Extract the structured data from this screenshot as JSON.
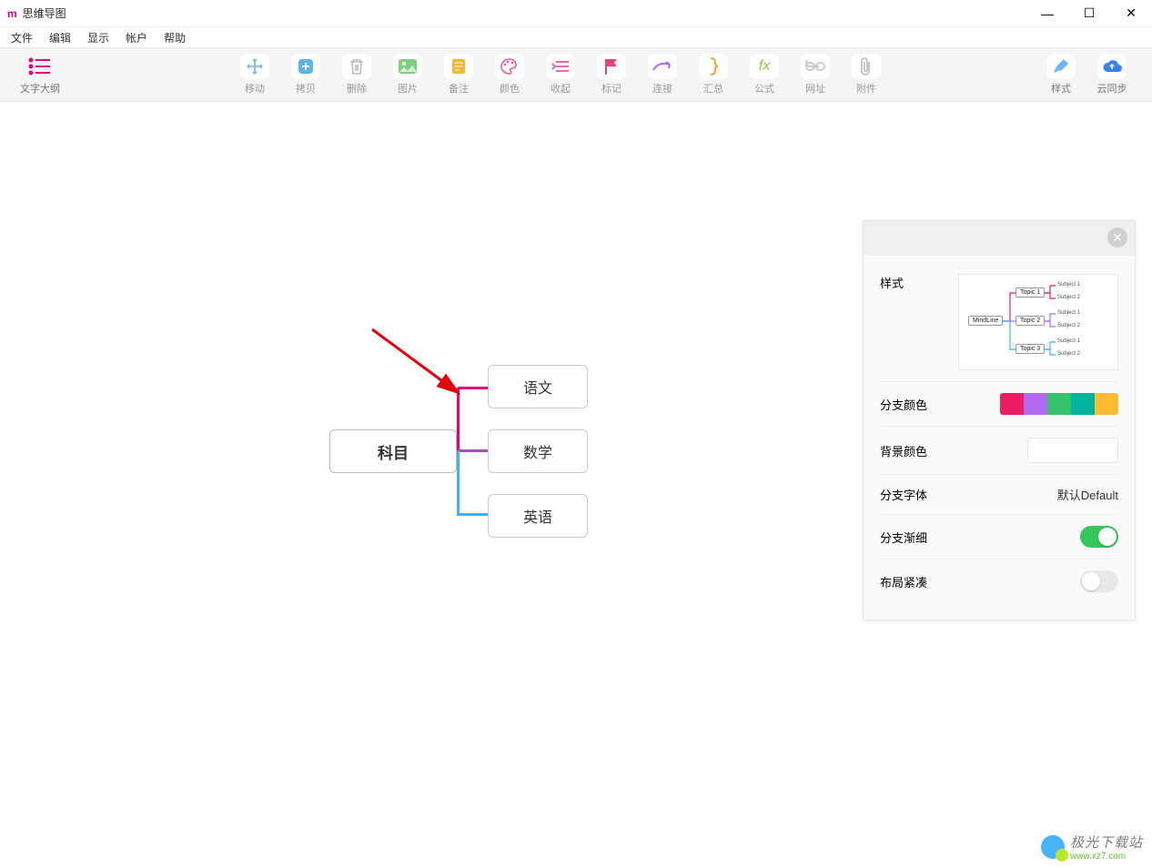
{
  "titlebar": {
    "app": "m",
    "title": "思维导图"
  },
  "menu": {
    "file": "文件",
    "edit": "编辑",
    "view": "显示",
    "account": "帐户",
    "help": "帮助"
  },
  "toolbar": {
    "outline": "文字大纲",
    "move": "移动",
    "copy": "拷贝",
    "delete": "删除",
    "image": "图片",
    "note": "备注",
    "color": "颜色",
    "collapse": "收起",
    "mark": "标记",
    "connect": "连接",
    "summary": "汇总",
    "formula": "公式",
    "url": "网址",
    "attach": "附件",
    "style": "样式",
    "sync": "云同步"
  },
  "mindmap": {
    "root": "科目",
    "children": [
      "语文",
      "数学",
      "英语"
    ]
  },
  "panel": {
    "style_label": "样式",
    "preview": {
      "root": "MindLine",
      "topics": [
        "Topic 1",
        "Topic 2",
        "Topic 3"
      ],
      "subs": [
        "Subject 1",
        "Subject 2"
      ]
    },
    "branch_color": "分支颜色",
    "palette": [
      "#e91e63",
      "#b368f0",
      "#35c26b",
      "#00b3a0",
      "#ffbb33"
    ],
    "bg_color": "背景颜色",
    "branch_font": "分支字体",
    "branch_font_value": "默认Default",
    "branch_taper": "分支渐细",
    "branch_taper_on": true,
    "layout_compact": "布局紧凑",
    "layout_compact_on": false
  },
  "watermark": {
    "line1": "极光下载站",
    "line2": "www.xz7.com"
  }
}
